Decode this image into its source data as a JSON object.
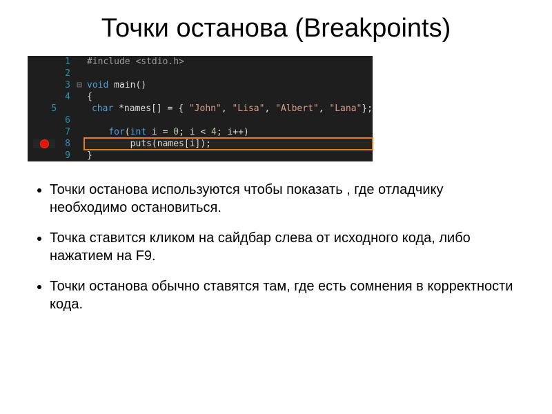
{
  "title": "Точки останова (Breakpoints)",
  "code": {
    "lines": [
      {
        "num": "1",
        "gutter": "",
        "fold": "",
        "tokens": [
          {
            "cls": "preproc",
            "t": "#include "
          },
          {
            "cls": "include-brackets",
            "t": "<stdio.h>"
          }
        ]
      },
      {
        "num": "2",
        "gutter": "",
        "fold": "",
        "tokens": []
      },
      {
        "num": "3",
        "gutter": "",
        "fold": "⊟",
        "tokens": [
          {
            "cls": "keyword",
            "t": "void"
          },
          {
            "cls": "ident",
            "t": " main()"
          }
        ]
      },
      {
        "num": "4",
        "gutter": "",
        "fold": "",
        "tokens": [
          {
            "cls": "brace",
            "t": "{"
          }
        ]
      },
      {
        "num": "5",
        "gutter": "",
        "fold": "",
        "tokens": [
          {
            "cls": "ident",
            "t": "    "
          },
          {
            "cls": "keyword",
            "t": "char"
          },
          {
            "cls": "ident",
            "t": " *names[] = { "
          },
          {
            "cls": "string",
            "t": "\"John\""
          },
          {
            "cls": "ident",
            "t": ", "
          },
          {
            "cls": "string",
            "t": "\"Lisa\""
          },
          {
            "cls": "ident",
            "t": ", "
          },
          {
            "cls": "string",
            "t": "\"Albert\""
          },
          {
            "cls": "ident",
            "t": ", "
          },
          {
            "cls": "string",
            "t": "\"Lana\""
          },
          {
            "cls": "ident",
            "t": "};"
          }
        ]
      },
      {
        "num": "6",
        "gutter": "",
        "fold": "",
        "tokens": []
      },
      {
        "num": "7",
        "gutter": "",
        "fold": "",
        "tokens": [
          {
            "cls": "ident",
            "t": "    "
          },
          {
            "cls": "keyword",
            "t": "for"
          },
          {
            "cls": "ident",
            "t": "("
          },
          {
            "cls": "keyword",
            "t": "int"
          },
          {
            "cls": "ident",
            "t": " i = "
          },
          {
            "cls": "number",
            "t": "0"
          },
          {
            "cls": "ident",
            "t": "; i < "
          },
          {
            "cls": "number",
            "t": "4"
          },
          {
            "cls": "ident",
            "t": "; i++)"
          }
        ]
      },
      {
        "num": "8",
        "gutter": "bp",
        "fold": "",
        "tokens": [
          {
            "cls": "ident",
            "t": "        puts(names[i]);"
          }
        ]
      },
      {
        "num": "9",
        "gutter": "",
        "fold": "",
        "tokens": [
          {
            "cls": "brace",
            "t": "}"
          }
        ]
      }
    ]
  },
  "bullets": {
    "items": [
      {
        "text": "Точки останова используются чтобы показать , где отладчику необходимо остановиться."
      },
      {
        "text": "Точка ставится кликом на сайдбар слева от исходного кода, либо нажатием на F9."
      },
      {
        "text": "Точки останова обычно ставятся там, где есть сомнения в корректности кода."
      }
    ]
  }
}
